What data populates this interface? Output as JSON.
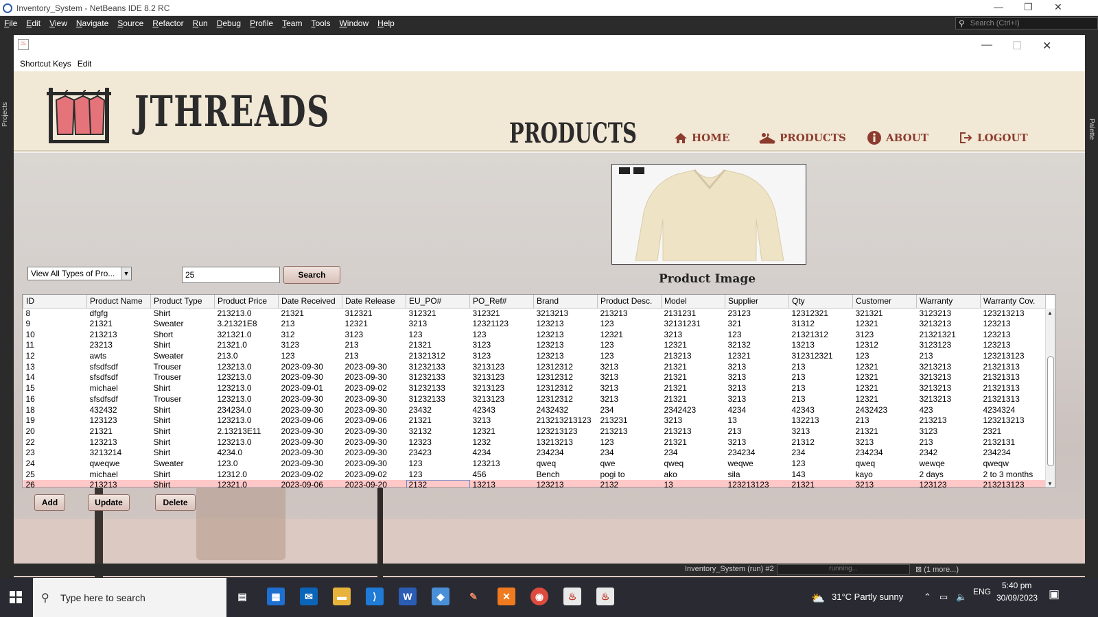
{
  "ide": {
    "title": "Inventory_System - NetBeans IDE 8.2 RC",
    "menu": [
      "File",
      "Edit",
      "View",
      "Navigate",
      "Source",
      "Refactor",
      "Run",
      "Debug",
      "Profile",
      "Team",
      "Tools",
      "Window",
      "Help"
    ],
    "search_placeholder": "Search (Ctrl+I)",
    "left_panel_label": "Projects",
    "right_panel_label": "Palette",
    "status_task": "Inventory_System (run) #2",
    "status_progress": "running...",
    "status_more": "(1 more...)"
  },
  "app": {
    "menu": [
      "Shortcut Keys",
      "Edit"
    ],
    "brand": "JTHREADS",
    "page_title": "PRODUCTS",
    "nav": [
      {
        "label": "HOME",
        "icon": "home-icon"
      },
      {
        "label": "PRODUCTS",
        "icon": "hanger-icon"
      },
      {
        "label": "ABOUT",
        "icon": "info-icon"
      },
      {
        "label": "LOGOUT",
        "icon": "logout-icon"
      }
    ],
    "filter_selected": "View All Types of Pro...",
    "search_value": "25",
    "search_button": "Search",
    "image_caption": "Product Image",
    "buttons": {
      "add": "Add",
      "update": "Update",
      "delete": "Delete"
    },
    "table": {
      "columns": [
        "ID",
        "Product Name",
        "Product Type",
        "Product Price",
        "Date Received",
        "Date Release",
        "EU_PO#",
        "PO_Ref#",
        "Brand",
        "Product Desc.",
        "Model",
        "Supplier",
        "Qty",
        "Customer",
        "Warranty",
        "Warranty Cov."
      ],
      "selected_row_index": 16,
      "rows": [
        [
          "8",
          "dfgfg",
          "Shirt",
          "213213.0",
          "21321",
          "312321",
          "312321",
          "312321",
          "3213213",
          "213213",
          "2131231",
          "23123",
          "12312321",
          "321321",
          "3123213",
          "123213213"
        ],
        [
          "9",
          "21321",
          "Sweater",
          "3.21321E8",
          "213",
          "12321",
          "3213",
          "12321123",
          "123213",
          "123",
          "32131231",
          "321",
          "31312",
          "12321",
          "3213213",
          "123213"
        ],
        [
          "10",
          "213213",
          "Short",
          "321321.0",
          "312",
          "3123",
          "123",
          "123",
          "123213",
          "12321",
          "3213",
          "123",
          "21321312",
          "3123",
          "21321321",
          "123213"
        ],
        [
          "11",
          "23213",
          "Shirt",
          "21321.0",
          "3123",
          "213",
          "21321",
          "3123",
          "123213",
          "123",
          "12321",
          "32132",
          "13213",
          "12312",
          "3123123",
          "123213"
        ],
        [
          "12",
          "awts",
          "Sweater",
          "213.0",
          "123",
          "213",
          "21321312",
          "3123",
          "123213",
          "123",
          "213213",
          "12321",
          "312312321",
          "123",
          "213",
          "123213123"
        ],
        [
          "13",
          "sfsdfsdf",
          "Trouser",
          "123213.0",
          "2023-09-30",
          "2023-09-30",
          "31232133",
          "3213123",
          "12312312",
          "3213",
          "21321",
          "3213",
          "213",
          "12321",
          "3213213",
          "21321313"
        ],
        [
          "14",
          "sfsdfsdf",
          "Trouser",
          "123213.0",
          "2023-09-30",
          "2023-09-30",
          "31232133",
          "3213123",
          "12312312",
          "3213",
          "21321",
          "3213",
          "213",
          "12321",
          "3213213",
          "21321313"
        ],
        [
          "15",
          "michael",
          "Shirt",
          "123213.0",
          "2023-09-01",
          "2023-09-02",
          "31232133",
          "3213123",
          "12312312",
          "3213",
          "21321",
          "3213",
          "213",
          "12321",
          "3213213",
          "21321313"
        ],
        [
          "16",
          "sfsdfsdf",
          "Trouser",
          "123213.0",
          "2023-09-30",
          "2023-09-30",
          "31232133",
          "3213123",
          "12312312",
          "3213",
          "21321",
          "3213",
          "213",
          "12321",
          "3213213",
          "21321313"
        ],
        [
          "18",
          "432432",
          "Shirt",
          "234234.0",
          "2023-09-30",
          "2023-09-30",
          "23432",
          "42343",
          "2432432",
          "234",
          "2342423",
          "4234",
          "42343",
          "2432423",
          "423",
          "4234324"
        ],
        [
          "19",
          "123123",
          "Shirt",
          "123213.0",
          "2023-09-06",
          "2023-09-06",
          "21321",
          "3213",
          "213213213123",
          "213231",
          "3213",
          "13",
          "132213",
          "213",
          "213213",
          "123213213"
        ],
        [
          "20",
          "21321",
          "Shirt",
          "2.13213E11",
          "2023-09-30",
          "2023-09-30",
          "32132",
          "12321",
          "123213123",
          "213213",
          "213213",
          "213",
          "3213",
          "21321",
          "3123",
          "2321"
        ],
        [
          "22",
          "123213",
          "Shirt",
          "123213.0",
          "2023-09-30",
          "2023-09-30",
          "12323",
          "1232",
          "13213213",
          "123",
          "21321",
          "3213",
          "21312",
          "3213",
          "213",
          "2132131"
        ],
        [
          "23",
          "3213214",
          "Shirt",
          "4234.0",
          "2023-09-30",
          "2023-09-30",
          "23423",
          "4234",
          "234234",
          "234",
          "234",
          "234234",
          "234",
          "234234",
          "2342",
          "234234"
        ],
        [
          "24",
          "qweqwe",
          "Sweater",
          "123.0",
          "2023-09-30",
          "2023-09-30",
          "123",
          "123213",
          "qweq",
          "qwe",
          "qweq",
          "weqwe",
          "123",
          "qweq",
          "wewqe",
          "qweqw"
        ],
        [
          "25",
          "michael",
          "Shirt",
          "12312.0",
          "2023-09-02",
          "2023-09-02",
          "123",
          "456",
          "Bench",
          "pogi to",
          "ako",
          "sila",
          "143",
          "kayo",
          "2 days",
          "2 to 3 months"
        ],
        [
          "26",
          "213213",
          "Shirt",
          "12321.0",
          "2023-09-06",
          "2023-09-20",
          "2132",
          "13213",
          "123213",
          "2132",
          "13",
          "123213123",
          "21321",
          "3213",
          "123123",
          "213213123"
        ]
      ]
    }
  },
  "taskbar": {
    "search_placeholder": "Type here to search",
    "weather": "31°C  Partly sunny",
    "language": "ENG",
    "time": "5:40 pm",
    "date": "30/09/2023"
  }
}
